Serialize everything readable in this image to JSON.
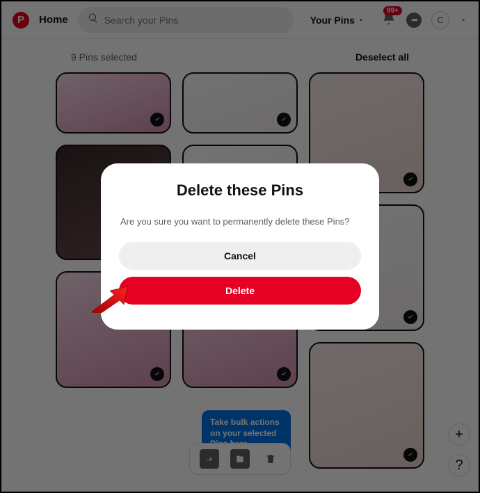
{
  "header": {
    "logo_letter": "P",
    "home": "Home",
    "search_placeholder": "Search your Pins",
    "your_pins": "Your Pins",
    "notif_count": "99+",
    "avatar_letter": "C"
  },
  "selection": {
    "count_text": "9 Pins selected",
    "deselect": "Deselect all"
  },
  "tooltip": {
    "text": "Take bulk actions on your selected Pins here"
  },
  "dialog": {
    "title": "Delete these Pins",
    "body": "Are you sure you want to permanently delete these Pins?",
    "cancel": "Cancel",
    "delete": "Delete"
  },
  "fab": {
    "plus": "+",
    "help": "?"
  },
  "pins": {
    "c1": [
      88,
      166,
      168
    ],
    "c2": [
      88,
      166,
      168
    ],
    "c3": [
      174,
      182,
      182
    ]
  }
}
